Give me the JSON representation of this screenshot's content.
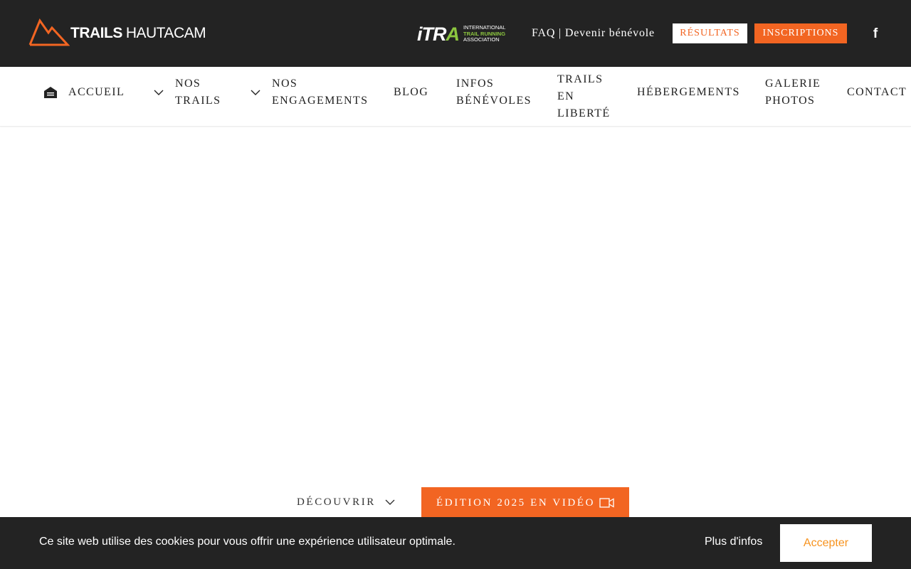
{
  "header": {
    "logo": {
      "word_bold": "TRAILS",
      "word_light": "HAUTACAM",
      "accent_color": "#f26522"
    },
    "itra": {
      "main_prefix": "iTR",
      "main_accent": "A",
      "line1": "INTERNATIONAL",
      "line2": "TRAIL RUNNING",
      "line3": "ASSOCIATION",
      "accent_color": "#8cc63f"
    },
    "links": {
      "faq": "FAQ",
      "separator": " | ",
      "volunteer": "Devenir bénévole"
    },
    "resultats_label": "RÉSULTATS",
    "inscriptions_label": "INSCRIPTIONS",
    "social_icon": "facebook-icon",
    "background": "#232323"
  },
  "nav": {
    "items": [
      {
        "line1": "ACCUEIL",
        "line2": "",
        "line3": ""
      },
      {
        "line1": "NOS",
        "line2": "TRAILS",
        "line3": ""
      },
      {
        "line1": "NOS",
        "line2": "ENGAGEMENTS",
        "line3": ""
      },
      {
        "line1": "BLOG",
        "line2": "",
        "line3": ""
      },
      {
        "line1": "INFOS",
        "line2": "BÉNÉVOLES",
        "line3": ""
      },
      {
        "line1": "TRAILS",
        "line2": "EN",
        "line3": "LIBERTÉ"
      },
      {
        "line1": "HÉBERGEMENTS",
        "line2": "",
        "line3": ""
      },
      {
        "line1": "GALERIE",
        "line2": "PHOTOS",
        "line3": ""
      },
      {
        "line1": "CONTACT",
        "line2": "",
        "line3": ""
      }
    ]
  },
  "hero": {
    "discover_label": "DÉCOUVRIR",
    "video_label": "ÉDITION 2025 EN VIDÉO",
    "video_icon": "video-camera-icon",
    "accent_color": "#f26522"
  },
  "cookie": {
    "message": "Ce site web utilise des cookies pour vous offrir une expérience utilisateur optimale.",
    "more_label": "Plus d'infos",
    "accept_label": "Accepter",
    "accept_text_color": "#f7931e"
  }
}
